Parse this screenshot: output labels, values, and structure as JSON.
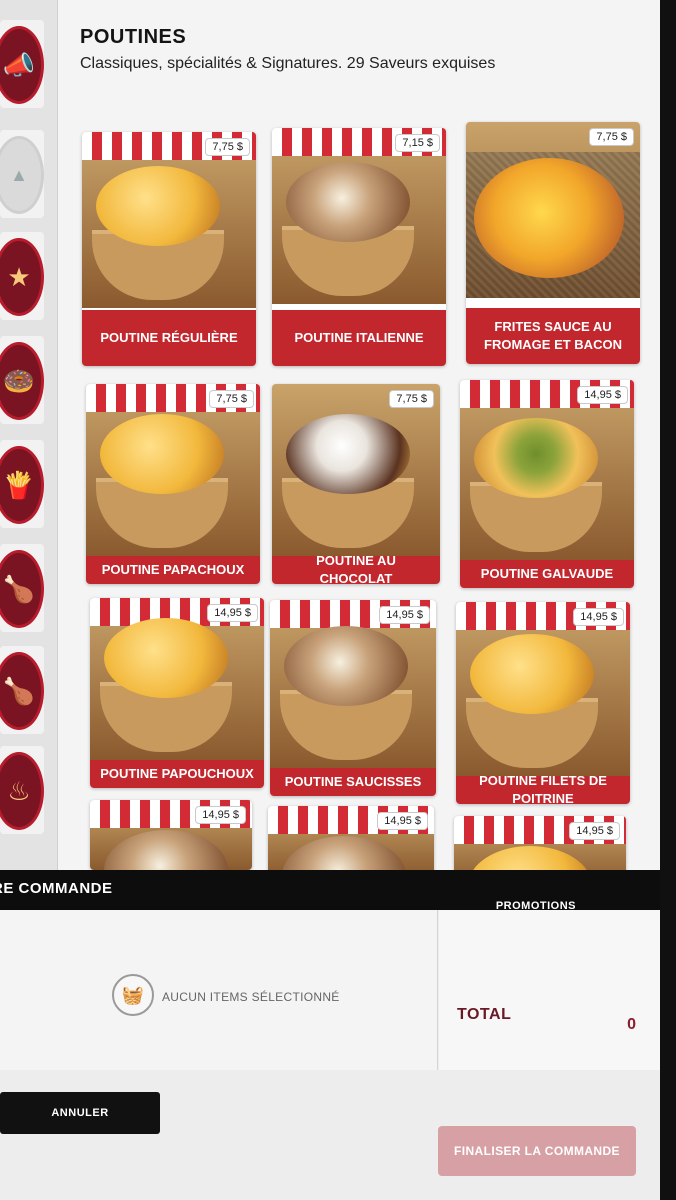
{
  "category": {
    "title": "POUTINES",
    "subtitle": "Classiques, spécialités & Signatures. 29 Saveurs exquises"
  },
  "rail": {
    "items": [
      {
        "icon": "megaphone-icon",
        "glyph": "📣"
      },
      {
        "icon": "image-placeholder-icon",
        "glyph": "▲"
      },
      {
        "icon": "star-icon",
        "glyph": "★"
      },
      {
        "icon": "drink-donut-icon",
        "glyph": "🍩"
      },
      {
        "icon": "fries-drink-icon",
        "glyph": "🍟"
      },
      {
        "icon": "chicken-bucket-icon",
        "glyph": "🍗"
      },
      {
        "icon": "roast-chicken-icon",
        "glyph": "🍗"
      },
      {
        "icon": "ribs-icon",
        "glyph": "♨"
      }
    ]
  },
  "products": [
    {
      "name": "POUTINE RÉGULIÈRE",
      "price": "7,75 $"
    },
    {
      "name": "POUTINE ITALIENNE",
      "price": "7,15 $"
    },
    {
      "name": "FRITES SAUCE AU FROMAGE ET BACON",
      "price": "7,75 $"
    },
    {
      "name": "POUTINE PAPACHOUX",
      "price": "7,75 $"
    },
    {
      "name": "POUTINE AU CHOCOLAT",
      "price": "7,75 $"
    },
    {
      "name": "POUTINE GALVAUDE",
      "price": "14,95 $"
    },
    {
      "name": "POUTINE PAPOUCHOUX",
      "price": "14,95 $"
    },
    {
      "name": "POUTINE SAUCISSES",
      "price": "14,95 $"
    },
    {
      "name": "POUTINE FILETS DE POITRINE",
      "price": "14,95 $"
    },
    {
      "name": "",
      "price": "14,95 $"
    },
    {
      "name": "",
      "price": "14,95 $"
    },
    {
      "name": "",
      "price": "14,95 $"
    }
  ],
  "order": {
    "title": "RE COMMANDE",
    "promotions": "PROMOTIONS",
    "empty_text": "AUCUN ITEMS SÉLECTIONNÉ",
    "total_label": "TOTAL",
    "total_value": "0",
    "cancel_label": "ANNULER",
    "finalize_label": "FINALISER LA COMMANDE"
  },
  "colors": {
    "accent_red": "#c1272d",
    "rail_circle": "#7a1422",
    "finalize_disabled": "#d7a0a4"
  }
}
